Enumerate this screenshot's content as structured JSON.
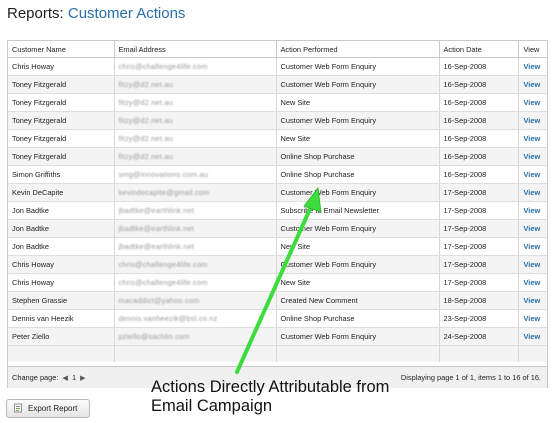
{
  "page": {
    "title_prefix": "Reports:",
    "title_section": "Customer Actions"
  },
  "grid": {
    "headers": [
      "Customer Name",
      "Email Address",
      "Action Performed",
      "Action Date",
      "View"
    ],
    "rows": [
      {
        "name": "Chris Howay",
        "email": "chris@challenge4life.com",
        "action": "Customer Web Form Enquiry",
        "date": "16-Sep-2008",
        "view": "View"
      },
      {
        "name": "Toney Fitzgerald",
        "email": "fitzy@d2.net.au",
        "action": "Customer Web Form Enquiry",
        "date": "16-Sep-2008",
        "view": "View"
      },
      {
        "name": "Toney Fitzgerald",
        "email": "fitzy@d2.net.au",
        "action": "New Site",
        "date": "16-Sep-2008",
        "view": "View"
      },
      {
        "name": "Toney Fitzgerald",
        "email": "fitzy@d2.net.au",
        "action": "Customer Web Form Enquiry",
        "date": "16-Sep-2008",
        "view": "View"
      },
      {
        "name": "Toney Fitzgerald",
        "email": "fitzy@d2.net.au",
        "action": "New Site",
        "date": "16-Sep-2008",
        "view": "View"
      },
      {
        "name": "Toney Fitzgerald",
        "email": "fitzy@d2.net.au",
        "action": "Online Shop Purchase",
        "date": "16-Sep-2008",
        "view": "View"
      },
      {
        "name": "Simon Griffiths",
        "email": "smg@innovations.com.au",
        "action": "Online Shop Purchase",
        "date": "16-Sep-2008",
        "view": "View"
      },
      {
        "name": "Kevin DeCapite",
        "email": "kevindecapite@gmail.com",
        "action": "Customer Web Form Enquiry",
        "date": "17-Sep-2008",
        "view": "View"
      },
      {
        "name": "Jon Badtke",
        "email": "jbadtke@earthlink.net",
        "action": "Subscribe to Email Newsletter",
        "date": "17-Sep-2008",
        "view": "View"
      },
      {
        "name": "Jon Badtke",
        "email": "jbadtke@earthlink.net",
        "action": "Customer Web Form Enquiry",
        "date": "17-Sep-2008",
        "view": "View"
      },
      {
        "name": "Jon Badtke",
        "email": "jbadtke@earthlink.net",
        "action": "New Site",
        "date": "17-Sep-2008",
        "view": "View"
      },
      {
        "name": "Chris Howay",
        "email": "chris@challenge4life.com",
        "action": "Customer Web Form Enquiry",
        "date": "17-Sep-2008",
        "view": "View"
      },
      {
        "name": "Chris Howay",
        "email": "chris@challenge4life.com",
        "action": "New Site",
        "date": "17-Sep-2008",
        "view": "View"
      },
      {
        "name": "Stephen Grassie",
        "email": "macaddict@yahoo.com",
        "action": "Created New Comment",
        "date": "18-Sep-2008",
        "view": "View"
      },
      {
        "name": "Dennis van Heezik",
        "email": "dennis.vanheezik@bsl.co.nz",
        "action": "Online Shop Purchase",
        "date": "23-Sep-2008",
        "view": "View"
      },
      {
        "name": "Peter Ziello",
        "email": "pziello@sachlin.com",
        "action": "Customer Web Form Enquiry",
        "date": "24-Sep-2008",
        "view": "View"
      }
    ]
  },
  "pager": {
    "change_page_label": "Change page:",
    "prev_icon": "triangle-left-icon",
    "next_icon": "triangle-right-icon",
    "current_page": "1",
    "summary": "Displaying page 1 of 1, items 1 to 16 of 16."
  },
  "export": {
    "label": "Export Report",
    "icon": "export-document-icon"
  },
  "annotation": {
    "line1": "Actions Directly Attributable from",
    "line2": "Email Campaign",
    "arrow_color": "#3ddc3d"
  },
  "colors": {
    "link": "#2a6ea8",
    "accent_title": "#2a6ea8"
  }
}
